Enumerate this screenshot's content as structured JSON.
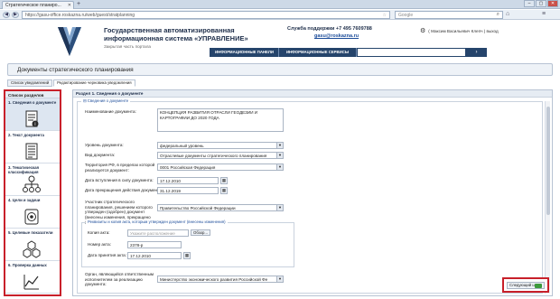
{
  "browser": {
    "tab_title": "Стратегическое планиро...",
    "tab_close": "✕",
    "new_tab": "+",
    "url": "https://gasu-office.roskazna.ru/web/guest/stratplanning",
    "search_placeholder": "Google",
    "window_buttons": [
      "–",
      "▢",
      "✕"
    ]
  },
  "header": {
    "title": "Государственная автоматизированная информационная система «УПРАВЛЕНИЕ»",
    "subtitle": "Закрытая часть портала",
    "support": "Служба поддержки  +7 495 7609788",
    "support_email": "gasu@roskazna.ru",
    "user": "( Максим Васильевич Клепч ) выход",
    "menu": [
      "ИНФОРМАЦИОННЫЕ ПАНЕЛИ",
      "ИНФОРМАЦИОННЫЕ СЕРВИСЫ"
    ],
    "search_button": "›"
  },
  "page": {
    "title": "Документы стратегического планирования",
    "tabs": [
      "Список уведомлений",
      "Редактирование черновика уведомления"
    ]
  },
  "sections": {
    "head": "Список разделов",
    "items": [
      {
        "label": "1. Сведения о документе",
        "icon": "document-info-icon"
      },
      {
        "label": "2. Текст документа",
        "icon": "document-text-icon"
      },
      {
        "label": "3. Тематическая классификация",
        "icon": "classification-tree-icon"
      },
      {
        "label": "4. Цели и задачи",
        "icon": "target-icon"
      },
      {
        "label": "5. Целевые показатели",
        "icon": "hexagons-icon"
      },
      {
        "label": "6. Проверка данных",
        "icon": "check-chart-icon"
      }
    ]
  },
  "form": {
    "section_head": "Раздел 1. Сведения о документе",
    "legend": "Сведения о документе",
    "fields": {
      "name_label": "Наименование документа:",
      "name_value": "КОНЦЕПЦИЯ РАЗВИТИЯ ОТРАСЛИ ГЕОДЕЗИИ И КАРТОГРАФИИ ДО 2020 ГОДА",
      "level_label": "Уровень документа:",
      "level_value": "федеральный уровень",
      "kind_label": "Вид документа:",
      "kind_value": "Отраслевые документы стратегического планирования",
      "territory_label": "Территория РФ, в пределах которой реализуется документ:",
      "territory_value": "0001 Российская Федерация",
      "start_label": "Дата вступления в силу документа:",
      "start_value": "17.12.2010",
      "end_label": "Дата прекращения действия документа:",
      "end_value": "31.12.2019",
      "participant_label": "Участник стратегического планирования, решением которого утвержден (одобрен) документ (внесены изменения, прекращено действие):",
      "participant_value": "Правительство Российской Федерации",
      "sub_legend": "Реквизиты и копия акта, которым утвержден документ (внесены изменения)",
      "copy_label": "Копия акта:",
      "copy_placeholder": "Укажите расположение",
      "browse": "Обзор...",
      "number_label": "Номер акта:",
      "number_value": "2378-р",
      "accept_label": "Дата принятия акта:",
      "accept_value": "17.12.2010",
      "organ_label": "Орган, являющийся ответственным исполнителем за реализацию документа:",
      "organ_value": "Министерство экономического развития Российской Фе"
    }
  },
  "actions": {
    "next": "Следующий шаг"
  }
}
